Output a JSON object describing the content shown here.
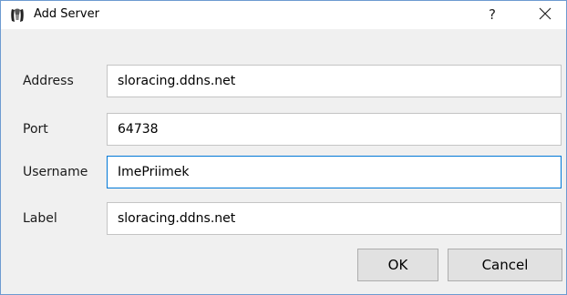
{
  "window": {
    "title": "Add Server",
    "help_glyph": "?",
    "close_icon": "close-icon",
    "app_icon": "mumble-icon"
  },
  "form": {
    "address": {
      "label": "Address",
      "value": "sloracing.ddns.net"
    },
    "port": {
      "label": "Port",
      "value": "64738"
    },
    "username": {
      "label": "Username",
      "value": "ImePriimek"
    },
    "server_label": {
      "label": "Label",
      "value": "sloracing.ddns.net"
    }
  },
  "buttons": {
    "ok": "OK",
    "cancel": "Cancel"
  },
  "colors": {
    "window_border": "#6d9bd1",
    "focus_border": "#0078d7",
    "dialog_background": "#f0f0f0"
  }
}
